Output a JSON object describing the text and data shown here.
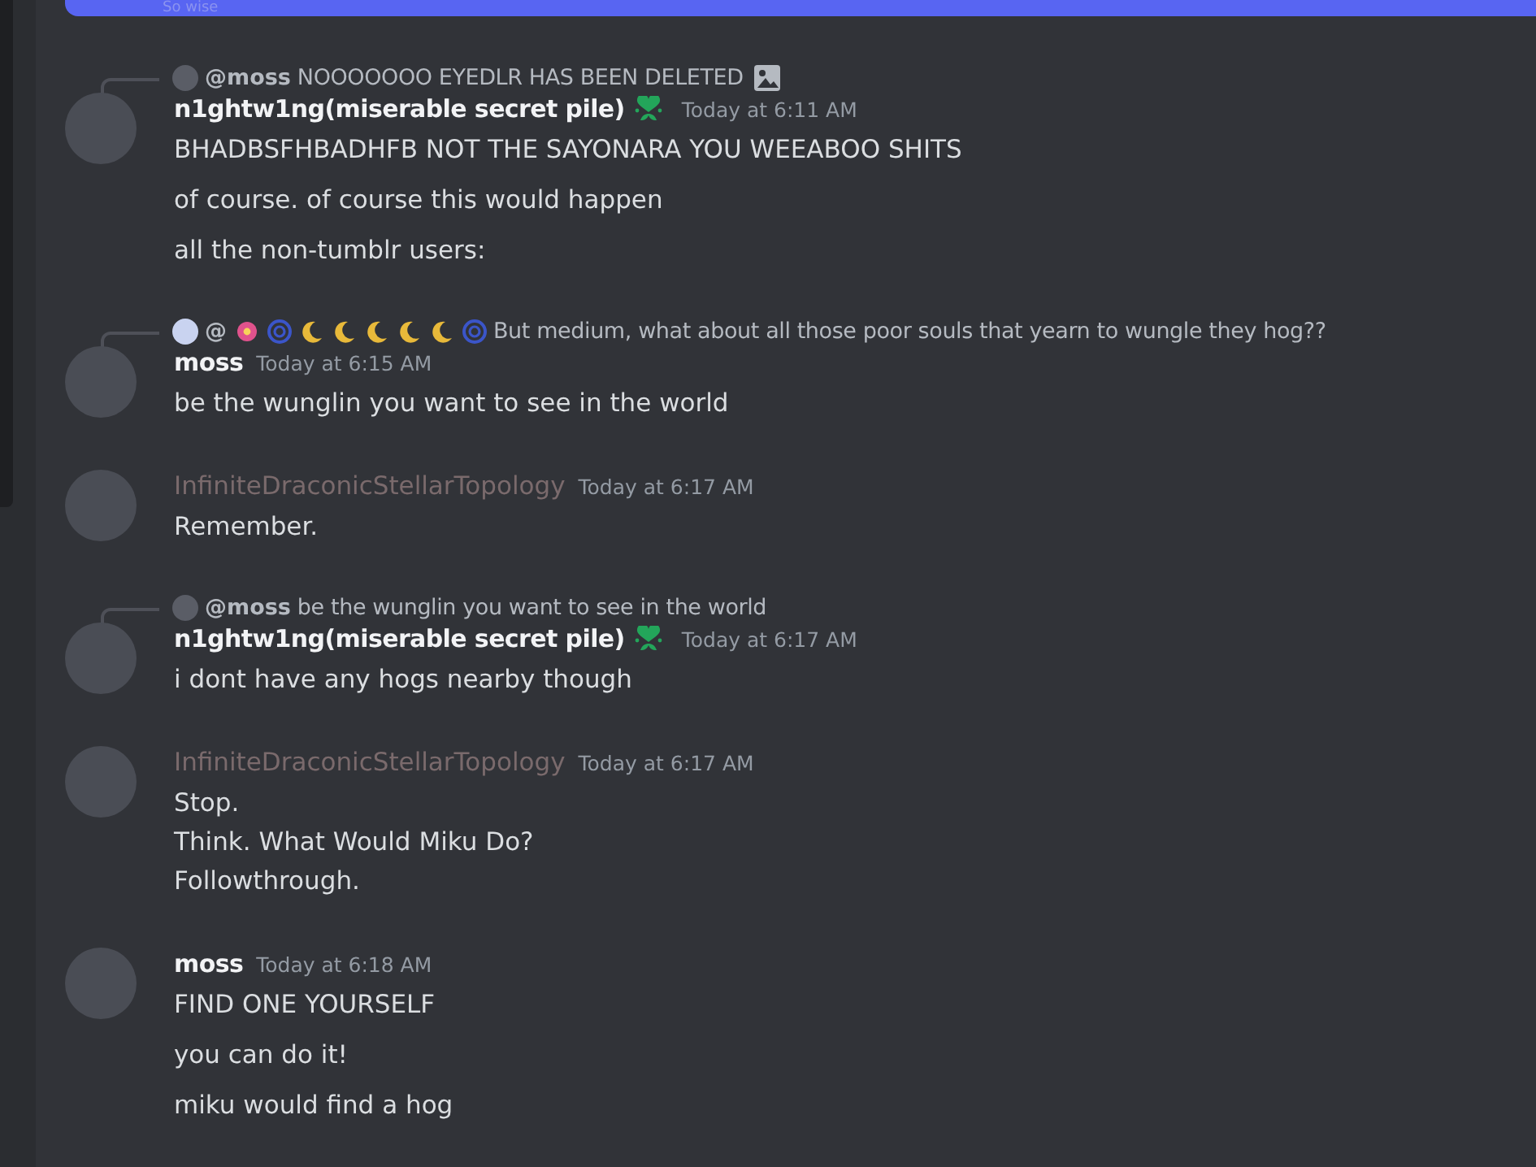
{
  "top_message": {
    "text": "So wise"
  },
  "groups": [
    {
      "reply": {
        "author": "@moss",
        "text": "NOOOOOOO EYEDLR HAS BEEN DELETED",
        "image_attachment": true
      },
      "author": "n1ghtw1ng(miserable secret pile)",
      "color": "#f2f3f5",
      "badge": true,
      "time": "Today at 6:11 AM",
      "messages": [
        [
          "BHADBSFHBADHFB NOT THE SAYONARA YOU WEEABOO SHITS"
        ],
        [
          "of course. of course this would happen"
        ],
        [
          "all the non-tumblr users:"
        ]
      ]
    },
    {
      "reply": {
        "kind": "emoji_name",
        "author": "@",
        "text": "But medium, what about all those poor souls that yearn to wungle they hog??"
      },
      "author": "moss",
      "color": "#f2f3f5",
      "time": "Today at 6:15 AM",
      "messages": [
        [
          "be the wunglin you want to see in the world"
        ]
      ]
    },
    {
      "author": "InfiniteDraconicStellarTopology",
      "color": "#7a6a6c",
      "time": "Today at 6:17 AM",
      "messages": [
        [
          "Remember."
        ]
      ]
    },
    {
      "reply": {
        "author": "@moss",
        "text": "be the wunglin you want to see in the world"
      },
      "author": "n1ghtw1ng(miserable secret pile)",
      "color": "#f2f3f5",
      "badge": true,
      "time": "Today at 6:17 AM",
      "messages": [
        [
          "i dont have any hogs nearby though"
        ]
      ]
    },
    {
      "author": "InfiniteDraconicStellarTopology",
      "color": "#7a6a6c",
      "time": "Today at 6:17 AM",
      "messages": [
        [
          "Stop.",
          "Think. What Would Miku Do?",
          "Followthrough."
        ]
      ]
    },
    {
      "author": "moss",
      "color": "#f2f3f5",
      "time": "Today at 6:18 AM",
      "messages": [
        [
          "FIND ONE YOURSELF"
        ],
        [
          "you can do it!"
        ],
        [
          "miku would find a hog"
        ]
      ]
    }
  ]
}
